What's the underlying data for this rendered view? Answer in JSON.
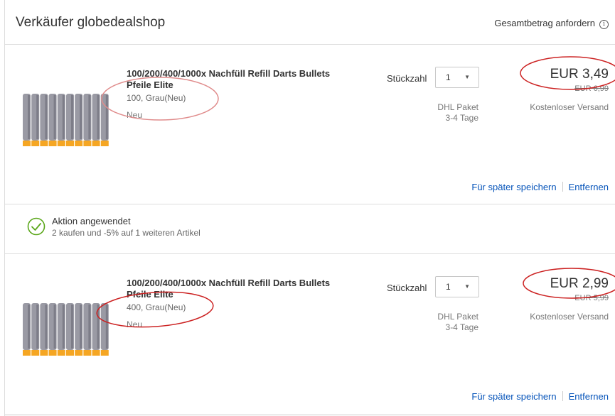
{
  "seller": {
    "title": "Verkäufer globedealshop",
    "total_request": "Gesamtbetrag anfordern",
    "info_glyph": "i"
  },
  "items": [
    {
      "title": "100/200/400/1000x Nachfüll Refill Darts Bullets Pfeile Elite",
      "variant": "100, Grau(Neu)",
      "condition": "Neu",
      "qty_label": "Stückzahl",
      "qty_value": "1",
      "ship_method": "DHL Paket",
      "ship_time": "3-4 Tage",
      "price": "EUR 3,49",
      "old_price": "EUR 6,99",
      "shipping": "Kostenloser Versand",
      "save_later": "Für später speichern",
      "remove": "Entfernen"
    },
    {
      "title": "100/200/400/1000x Nachfüll Refill Darts Bullets Pfeile Elite",
      "variant": "400, Grau(Neu)",
      "condition": "Neu",
      "qty_label": "Stückzahl",
      "qty_value": "1",
      "ship_method": "DHL Paket",
      "ship_time": "3-4 Tage",
      "price": "EUR 2,99",
      "old_price": "EUR 5,99",
      "shipping": "Kostenloser Versand",
      "save_later": "Für später speichern",
      "remove": "Entfernen"
    }
  ],
  "promo": {
    "title": "Aktion angewendet",
    "description": "2 kaufen und -5% auf 1 weiteren Artikel",
    "icon": "checkmark-circle-icon"
  },
  "colors": {
    "link": "#0654ba",
    "check_green": "#5ba71b",
    "annotation_red": "#cc2222",
    "dart_gray": "#9a9aa4",
    "dart_tip": "#f5a623"
  }
}
